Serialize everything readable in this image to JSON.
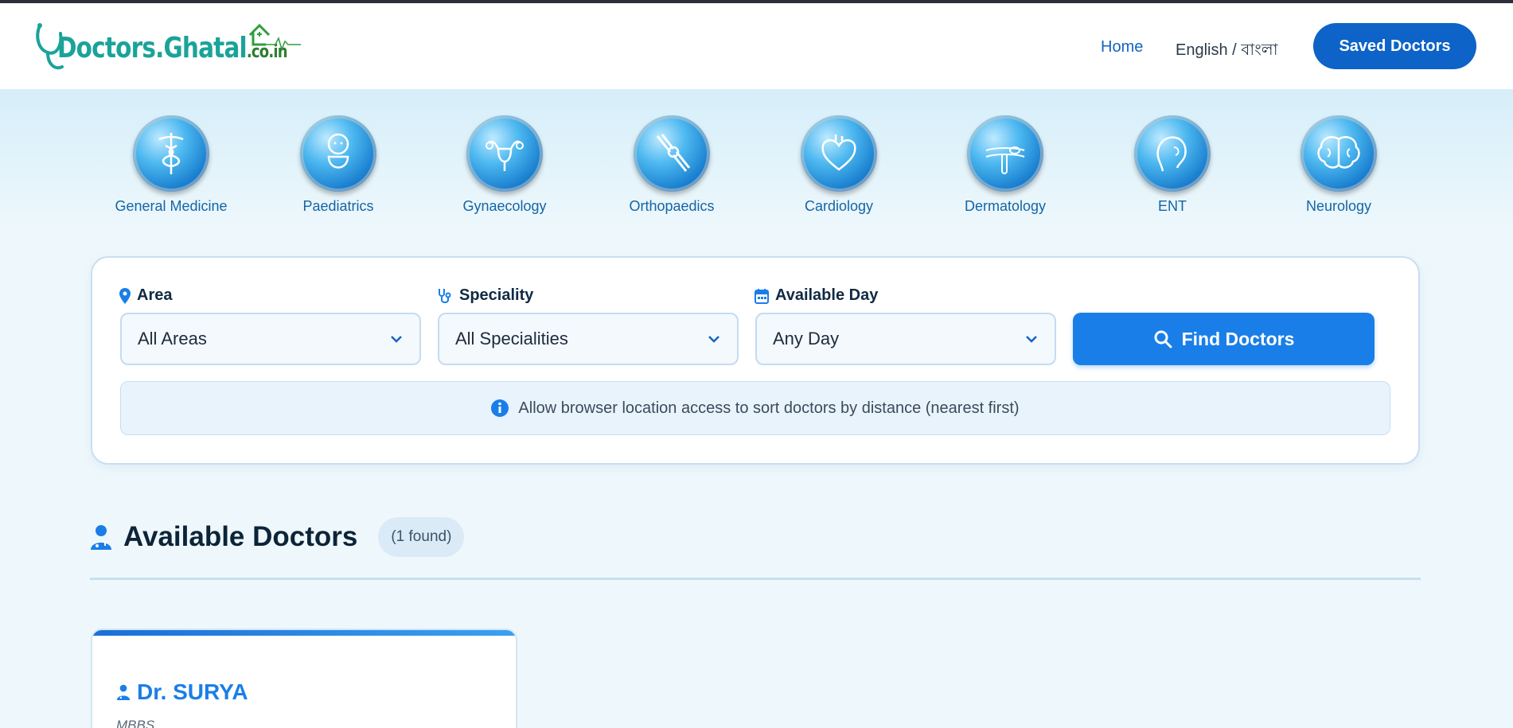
{
  "brand": {
    "name": "Doctors.Ghatal",
    "suffix": ".co.in"
  },
  "nav": {
    "home": "Home",
    "language": "English / বাংলা",
    "saved": "Saved Doctors"
  },
  "specialities": [
    {
      "label": "General Medicine",
      "icon": "caduceus-icon"
    },
    {
      "label": "Paediatrics",
      "icon": "baby-icon"
    },
    {
      "label": "Gynaecology",
      "icon": "uterus-icon"
    },
    {
      "label": "Orthopaedics",
      "icon": "knee-joint-icon"
    },
    {
      "label": "Cardiology",
      "icon": "heart-icon"
    },
    {
      "label": "Dermatology",
      "icon": "skin-icon"
    },
    {
      "label": "ENT",
      "icon": "ear-nose-throat-icon"
    },
    {
      "label": "Neurology",
      "icon": "brain-icon"
    }
  ],
  "search": {
    "area_label": "Area",
    "area_value": "All Areas",
    "speciality_label": "Speciality",
    "speciality_value": "All Specialities",
    "day_label": "Available Day",
    "day_value": "Any Day",
    "find_button": "Find Doctors",
    "info_text": "Allow browser location access to sort doctors by distance (nearest first)"
  },
  "results": {
    "title": "Available Doctors",
    "count": "(1 found)"
  },
  "doctors": [
    {
      "name": "Dr. SURYA",
      "degree": "MBBS"
    }
  ],
  "colors": {
    "primary": "#1a7ee8",
    "brand_teal": "#1aa39a",
    "nav_button": "#0d63c7"
  }
}
